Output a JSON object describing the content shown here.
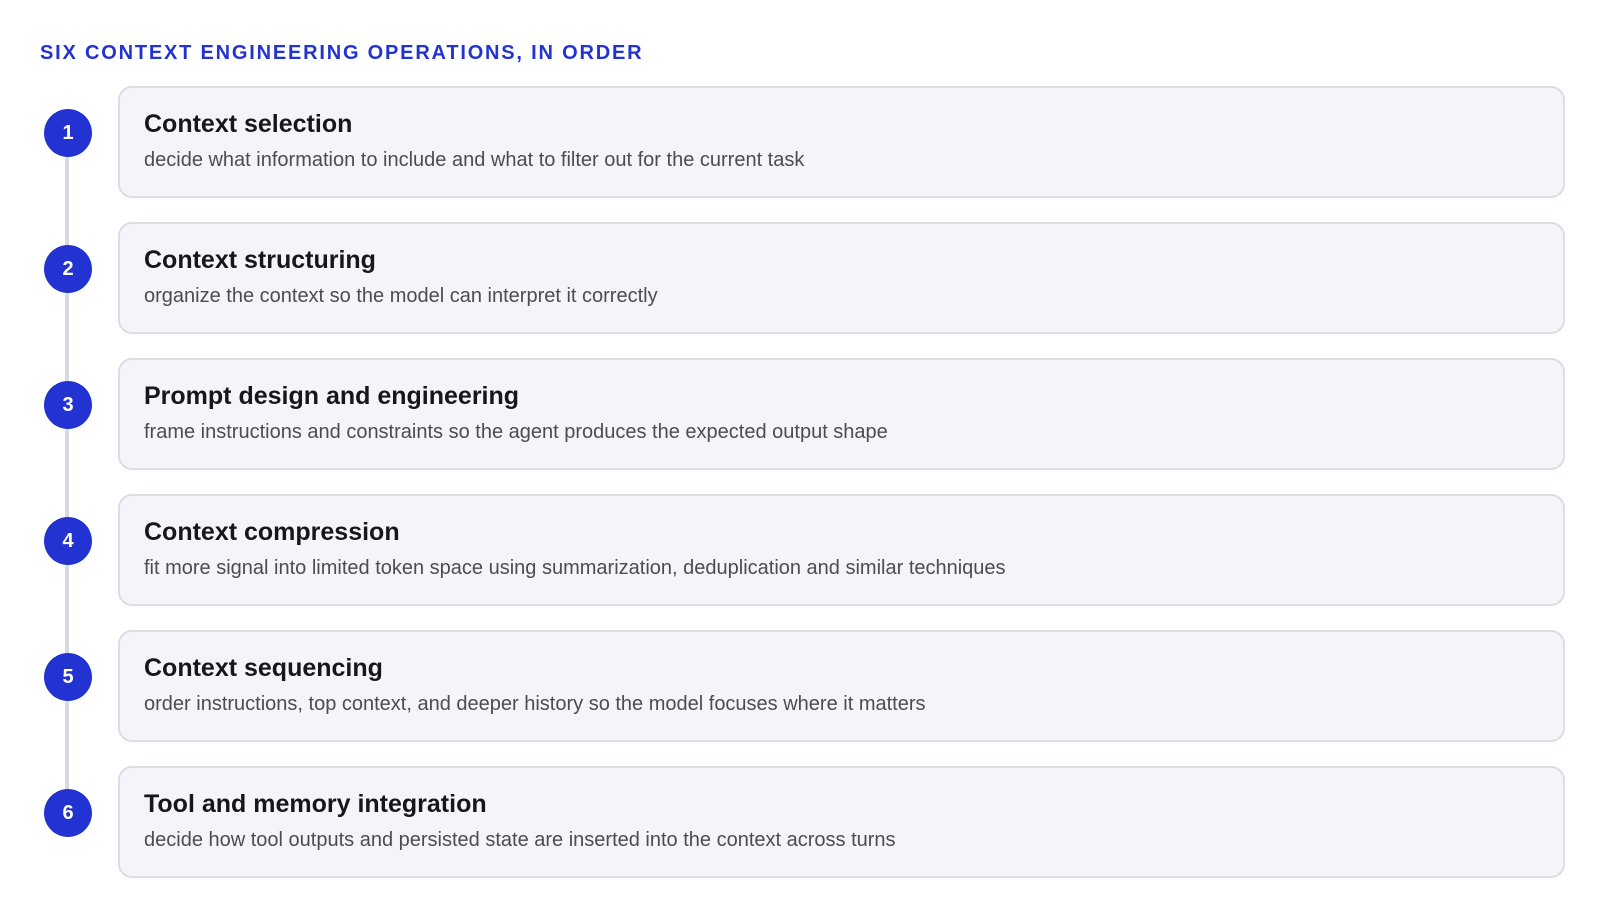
{
  "heading": "SIX CONTEXT ENGINEERING OPERATIONS, IN ORDER",
  "colors": {
    "accent": "#2233d1",
    "card_background": "#f4f5f8",
    "card_border": "#dcdee5",
    "connector": "#d7d9e2"
  },
  "steps": [
    {
      "number": "1",
      "title": "Context selection",
      "description": "decide what information to include and what to filter out for the current task"
    },
    {
      "number": "2",
      "title": "Context structuring",
      "description": "organize the context so the model can interpret it correctly"
    },
    {
      "number": "3",
      "title": "Prompt design and engineering",
      "description": "frame instructions and constraints so the agent produces the expected output shape"
    },
    {
      "number": "4",
      "title": "Context compression",
      "description": "fit more signal into limited token space using summarization, deduplication and similar techniques"
    },
    {
      "number": "5",
      "title": "Context sequencing",
      "description": "order instructions, top context, and deeper history so the model focuses where it matters"
    },
    {
      "number": "6",
      "title": "Tool and memory integration",
      "description": "decide how tool outputs and persisted state are inserted into the context across turns"
    }
  ]
}
